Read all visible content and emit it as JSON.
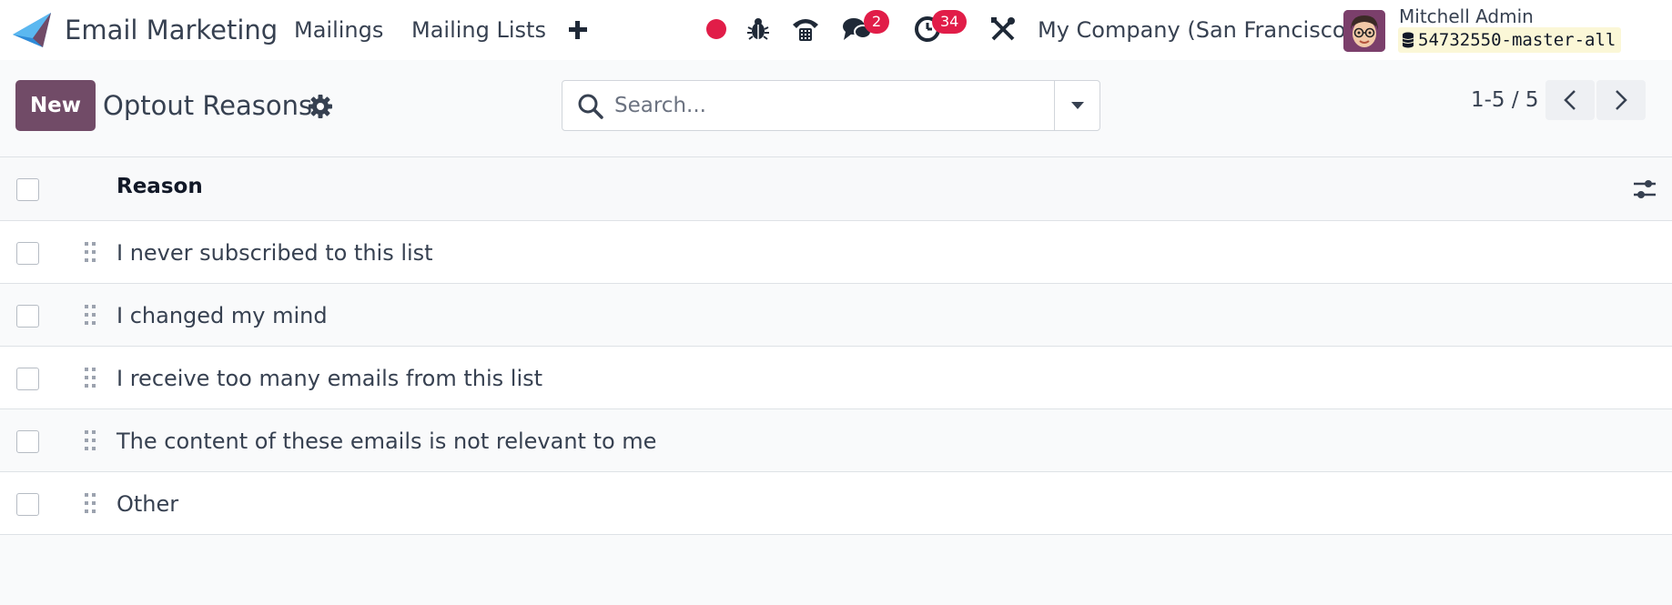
{
  "navbar": {
    "app_name": "Email Marketing",
    "menu": [
      "Mailings",
      "Mailing Lists"
    ],
    "messages_count": "2",
    "activities_count": "34",
    "company": "My Company (San Francisco)",
    "user_name": "Mitchell Admin",
    "database": "54732550-master-all"
  },
  "control_panel": {
    "new_label": "New",
    "title": "Optout Reasons",
    "search_placeholder": "Search...",
    "pager": "1-5 / 5"
  },
  "list": {
    "column": "Reason",
    "rows": [
      "I never subscribed to this list",
      "I changed my mind",
      "I receive too many emails from this list",
      "The content of these emails is not relevant to me",
      "Other"
    ]
  },
  "colors": {
    "brand": "#714b67",
    "badge": "#e11d48",
    "recording": "#e11d48"
  }
}
